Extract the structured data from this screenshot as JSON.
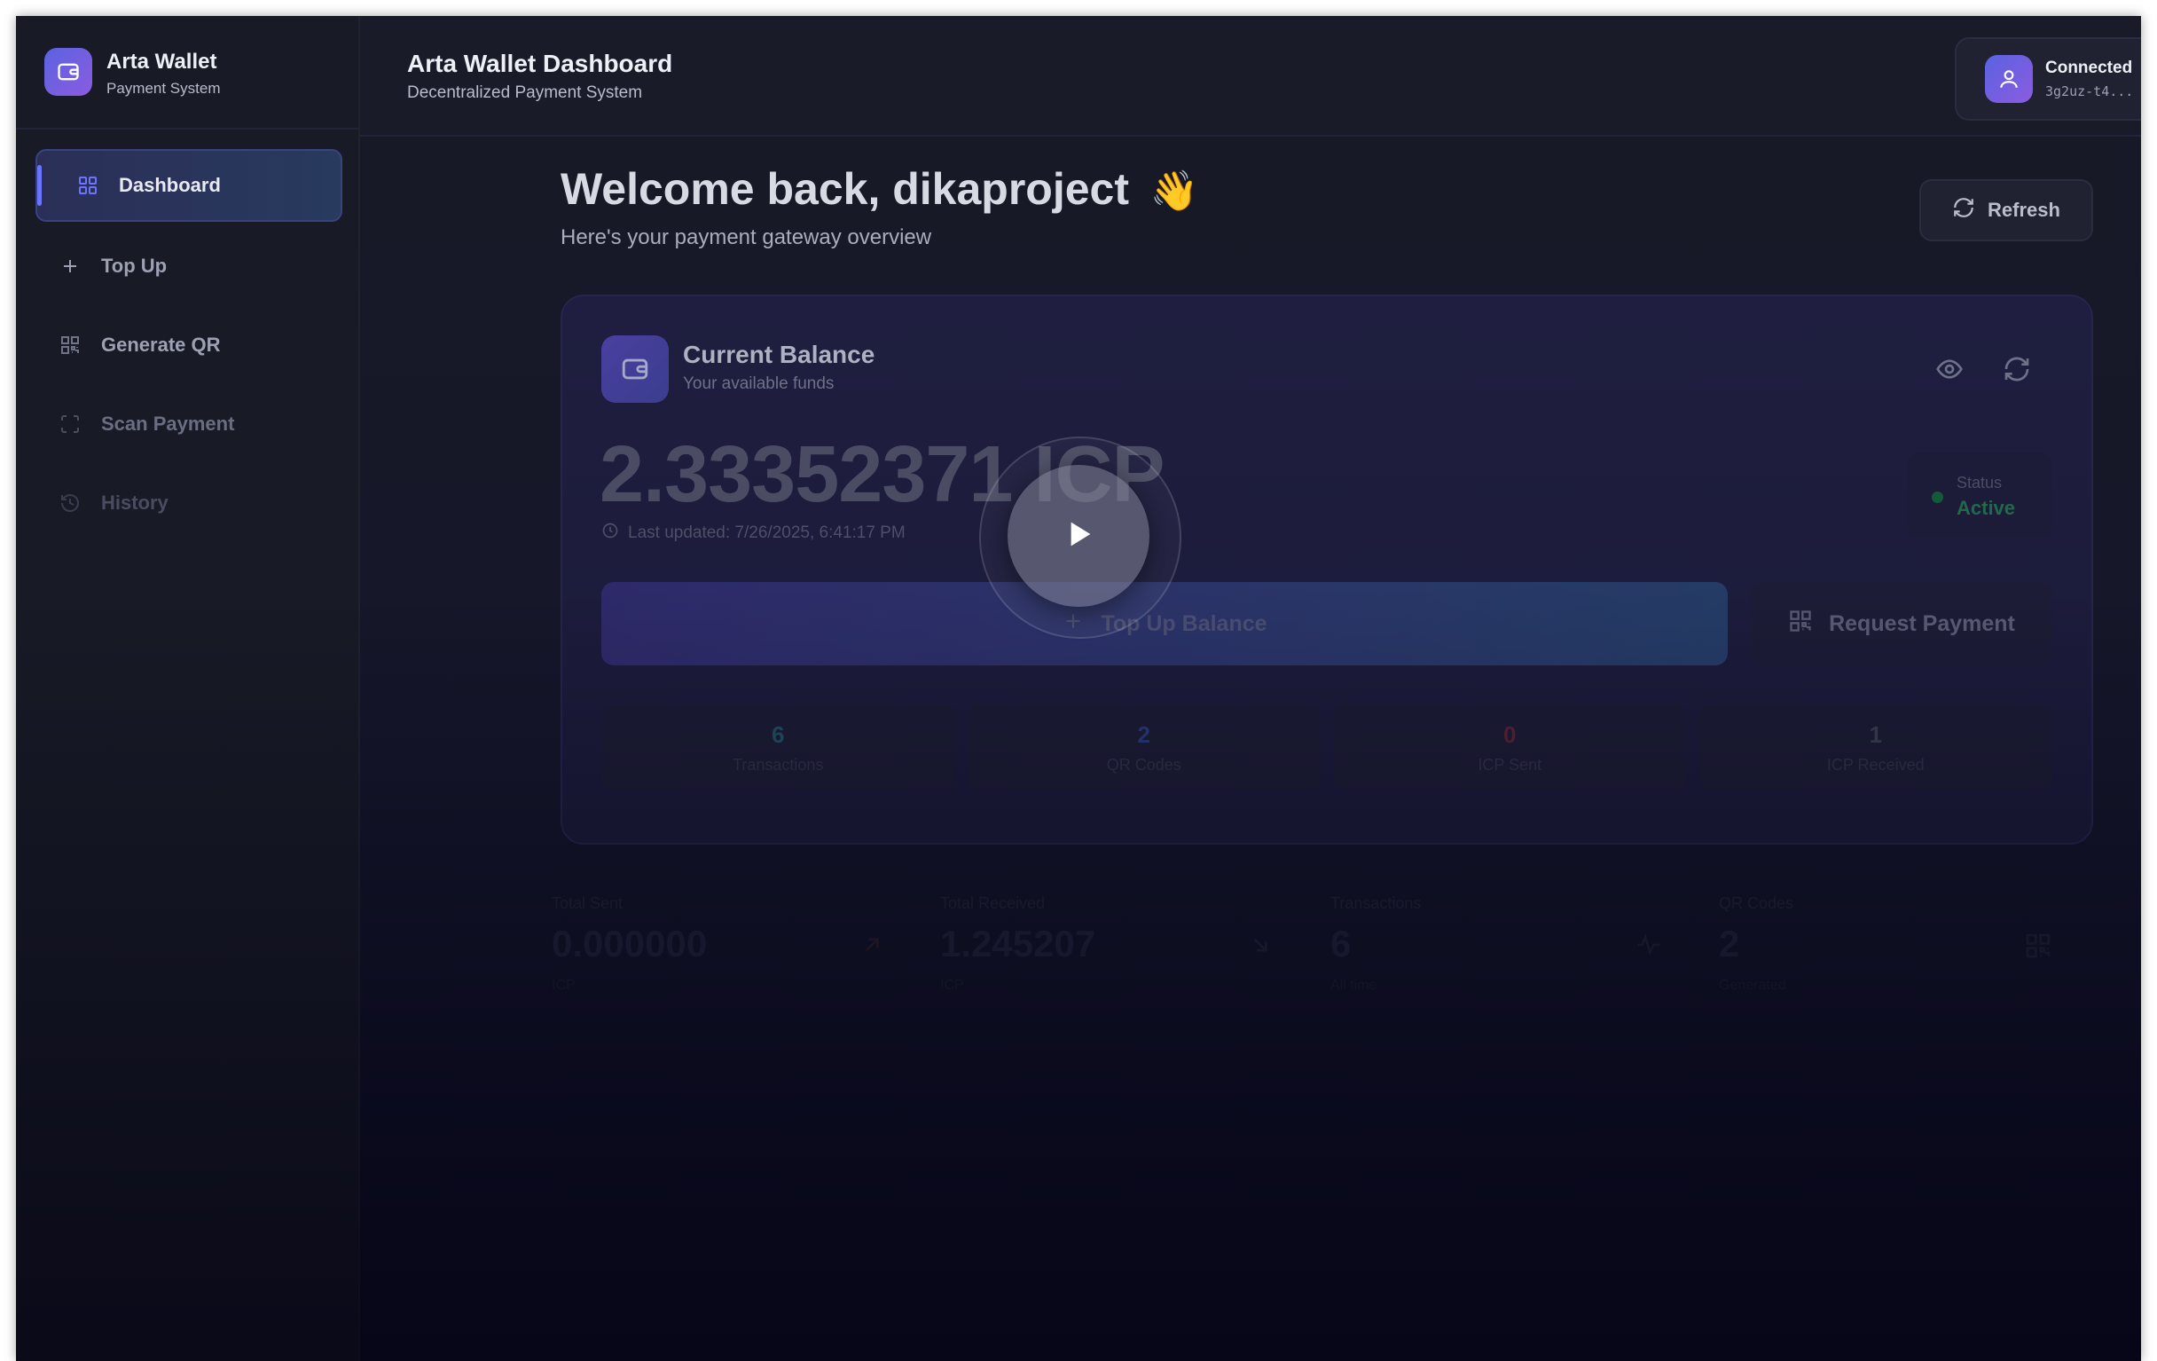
{
  "sidebar": {
    "brand_name": "Arta Wallet",
    "brand_sub": "Payment System",
    "items": [
      {
        "label": "Dashboard",
        "icon": "grid-icon",
        "active": true
      },
      {
        "label": "Top Up",
        "icon": "plus-icon"
      },
      {
        "label": "Generate QR",
        "icon": "qr-icon"
      },
      {
        "label": "Scan Payment",
        "icon": "scan-icon"
      },
      {
        "label": "History",
        "icon": "history-icon"
      }
    ]
  },
  "header": {
    "title": "Arta Wallet Dashboard",
    "subtitle": "Decentralized Payment System",
    "connection_label": "Connected",
    "connection_address": "3g2uz-t4..."
  },
  "main": {
    "welcome": "Welcome back, dikaproject",
    "welcome_emoji": "👋",
    "welcome_sub": "Here's your payment gateway overview",
    "refresh_label": "Refresh"
  },
  "balance": {
    "title": "Current Balance",
    "subtitle": "Your available funds",
    "amount": "2.33352371 ICP",
    "last_updated": "Last updated: 7/26/2025, 6:41:17 PM",
    "status_label": "Status",
    "status_value": "Active",
    "topup_label": "Top Up Balance",
    "request_label": "Request Payment",
    "mini_stats": [
      {
        "value": "6",
        "label": "Transactions",
        "color": "#1f4f63"
      },
      {
        "value": "2",
        "label": "QR Codes",
        "color": "#263a78"
      },
      {
        "value": "0",
        "label": "ICP Sent",
        "color": "#5a2232"
      },
      {
        "value": "1",
        "label": "ICP Received",
        "color": "#3a3d52"
      }
    ]
  },
  "stats": [
    {
      "label": "Total Sent",
      "value": "0.000000",
      "unit": "ICP",
      "icon": "arrow-up-right-icon"
    },
    {
      "label": "Total Received",
      "value": "1.245207",
      "unit": "ICP",
      "icon": "arrow-down-right-icon"
    },
    {
      "label": "Transactions",
      "value": "6",
      "unit": "All time",
      "icon": "activity-icon"
    },
    {
      "label": "QR Codes",
      "value": "2",
      "unit": "Generated",
      "icon": "qr-icon"
    }
  ],
  "colors": {
    "accent": "#6b74ff",
    "brand_gradient_start": "#5a63e0",
    "brand_gradient_end": "#8c5be0",
    "status_active": "#1e6a4b"
  },
  "overlay": {
    "icon": "play-icon"
  }
}
